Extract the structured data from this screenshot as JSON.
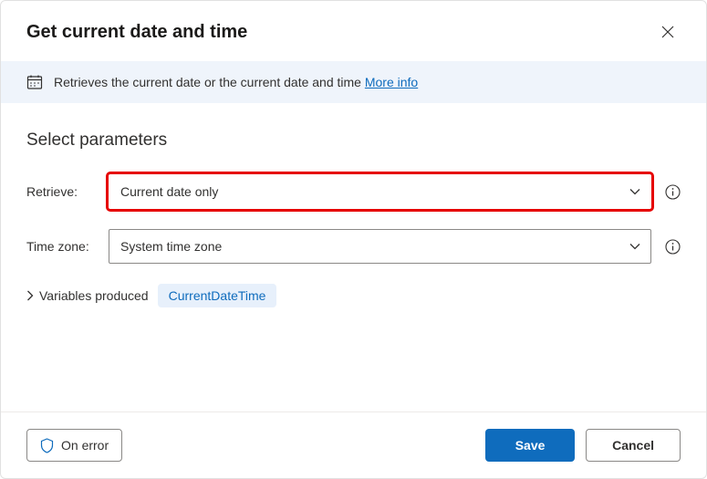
{
  "dialog": {
    "title": "Get current date and time",
    "info_text": "Retrieves the current date or the current date and time ",
    "more_info_label": "More info"
  },
  "parameters": {
    "section_title": "Select parameters",
    "retrieve": {
      "label": "Retrieve:",
      "value": "Current date only"
    },
    "timezone": {
      "label": "Time zone:",
      "value": "System time zone"
    },
    "variables": {
      "label": "Variables produced",
      "chip": "CurrentDateTime"
    }
  },
  "footer": {
    "on_error": "On error",
    "save": "Save",
    "cancel": "Cancel"
  }
}
